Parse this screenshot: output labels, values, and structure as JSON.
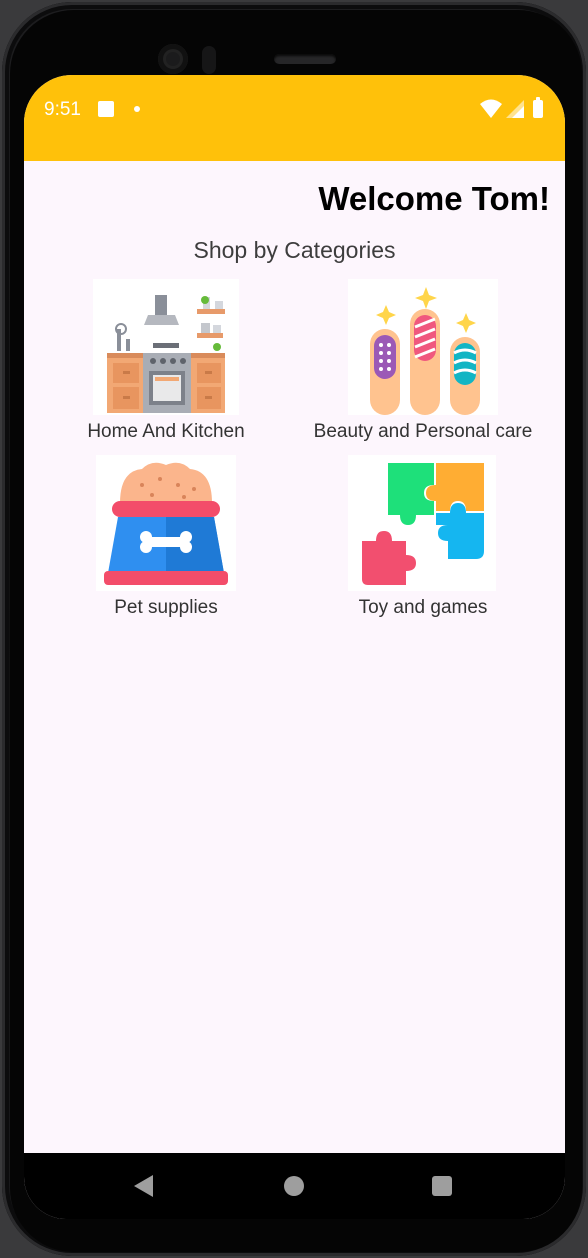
{
  "status_bar": {
    "time": "9:51",
    "icons": [
      "notification-square-icon",
      "notification-dot-icon",
      "wifi-icon",
      "signal-icon",
      "battery-icon"
    ]
  },
  "header": {
    "welcome": "Welcome Tom!"
  },
  "main": {
    "section_title": "Shop by Categories",
    "categories": [
      {
        "label": "Home And Kitchen",
        "icon": "kitchen-icon"
      },
      {
        "label": "Beauty and Personal care",
        "icon": "nail-polish-icon"
      },
      {
        "label": "Pet supplies",
        "icon": "pet-bowl-icon"
      },
      {
        "label": "Toy and games",
        "icon": "puzzle-icon"
      }
    ]
  },
  "nav_bar": {
    "icons": [
      "back-icon",
      "home-icon",
      "recents-icon"
    ]
  },
  "colors": {
    "status_bar": "#ffc10a",
    "screen_background": "#fdf6fd",
    "nav_bar": "#000000"
  }
}
